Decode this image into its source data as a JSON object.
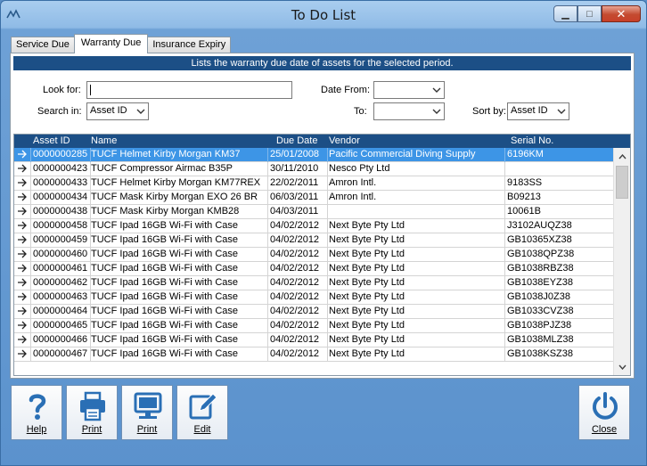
{
  "window": {
    "title": "To Do List",
    "close_glyph": "✕",
    "min_glyph": "▁",
    "max_glyph": "□"
  },
  "tabs": [
    {
      "label": "Service Due"
    },
    {
      "label": "Warranty Due"
    },
    {
      "label": "Insurance Expiry"
    }
  ],
  "active_tab": "Warranty Due",
  "banner": "Lists the warranty due date of assets for the selected period.",
  "filters": {
    "look_for_label": "Look for:",
    "look_for_value": "",
    "search_in_label": "Search in:",
    "search_in_value": "Asset ID",
    "date_from_label": "Date From:",
    "date_from_value": "",
    "to_label": "To:",
    "to_value": "",
    "sort_by_label": "Sort by:",
    "sort_by_value": "Asset ID"
  },
  "grid": {
    "columns": [
      "Asset ID",
      "Name",
      "Due Date",
      "Vendor",
      "Serial No."
    ],
    "selected_row": 0,
    "rows": [
      [
        "0000000285",
        "TUCF Helmet Kirby Morgan KM37",
        "25/01/2008",
        "Pacific Commercial Diving Supply",
        "6196KM"
      ],
      [
        "0000000423",
        "TUCF Compressor Airmac B35P",
        "30/11/2010",
        "Nesco Pty Ltd",
        ""
      ],
      [
        "0000000433",
        "TUCF Helmet Kirby Morgan KM77REX",
        "22/02/2011",
        "Amron Intl.",
        "9183SS"
      ],
      [
        "0000000434",
        "TUCF Mask Kirby Morgan EXO 26 BR",
        "06/03/2011",
        "Amron Intl.",
        "B09213"
      ],
      [
        "0000000438",
        "TUCF Mask Kirby Morgan KMB28",
        "04/03/2011",
        "",
        "10061B"
      ],
      [
        "0000000458",
        "TUCF Ipad 16GB Wi-Fi with Case",
        "04/02/2012",
        "Next Byte Pty Ltd",
        "J3102AUQZ38"
      ],
      [
        "0000000459",
        "TUCF Ipad 16GB Wi-Fi with Case",
        "04/02/2012",
        "Next Byte Pty Ltd",
        "GB10365XZ38"
      ],
      [
        "0000000460",
        "TUCF Ipad 16GB Wi-Fi with Case",
        "04/02/2012",
        "Next Byte Pty Ltd",
        "GB1038QPZ38"
      ],
      [
        "0000000461",
        "TUCF Ipad 16GB Wi-Fi with Case",
        "04/02/2012",
        "Next Byte Pty Ltd",
        "GB1038RBZ38"
      ],
      [
        "0000000462",
        "TUCF Ipad 16GB Wi-Fi with Case",
        "04/02/2012",
        "Next Byte Pty Ltd",
        "GB1038EYZ38"
      ],
      [
        "0000000463",
        "TUCF Ipad 16GB Wi-Fi with Case",
        "04/02/2012",
        "Next Byte Pty Ltd",
        "GB1038J0Z38"
      ],
      [
        "0000000464",
        "TUCF Ipad 16GB Wi-Fi with Case",
        "04/02/2012",
        "Next Byte Pty Ltd",
        "GB1033CVZ38"
      ],
      [
        "0000000465",
        "TUCF Ipad 16GB Wi-Fi with Case",
        "04/02/2012",
        "Next Byte Pty Ltd",
        "GB1038PJZ38"
      ],
      [
        "0000000466",
        "TUCF Ipad 16GB Wi-Fi with Case",
        "04/02/2012",
        "Next Byte Pty Ltd",
        "GB1038MLZ38"
      ],
      [
        "0000000467",
        "TUCF Ipad 16GB Wi-Fi with Case",
        "04/02/2012",
        "Next Byte Pty Ltd",
        "GB1038KSZ38"
      ]
    ]
  },
  "toolbar": {
    "help_label": "Help",
    "print1_label": "Print",
    "print2_label": "Print",
    "edit_label": "Edit",
    "close_label": "Close"
  },
  "icons": {
    "row_pointer": "arrow-right-icon",
    "help": "question-mark-icon",
    "print1": "printer-icon",
    "print2": "monitor-icon",
    "edit": "edit-pencil-icon",
    "close": "power-icon"
  },
  "colors": {
    "accent": "#1c4f86",
    "selection": "#3d95e6",
    "icon_blue": "#2a6fb5"
  }
}
